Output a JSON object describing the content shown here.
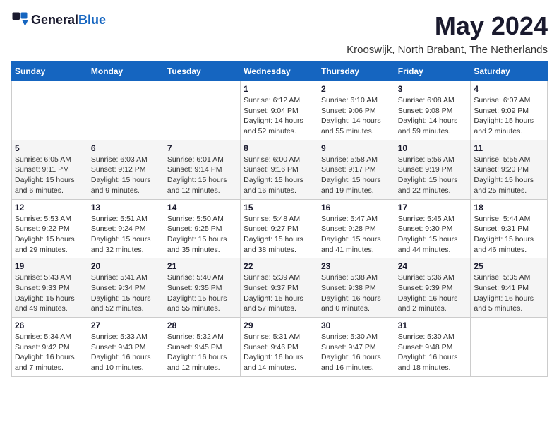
{
  "header": {
    "logo_general": "General",
    "logo_blue": "Blue",
    "month": "May 2024",
    "location": "Krooswijk, North Brabant, The Netherlands"
  },
  "days_of_week": [
    "Sunday",
    "Monday",
    "Tuesday",
    "Wednesday",
    "Thursday",
    "Friday",
    "Saturday"
  ],
  "weeks": [
    [
      {
        "day": "",
        "info": ""
      },
      {
        "day": "",
        "info": ""
      },
      {
        "day": "",
        "info": ""
      },
      {
        "day": "1",
        "info": "Sunrise: 6:12 AM\nSunset: 9:04 PM\nDaylight: 14 hours and 52 minutes."
      },
      {
        "day": "2",
        "info": "Sunrise: 6:10 AM\nSunset: 9:06 PM\nDaylight: 14 hours and 55 minutes."
      },
      {
        "day": "3",
        "info": "Sunrise: 6:08 AM\nSunset: 9:08 PM\nDaylight: 14 hours and 59 minutes."
      },
      {
        "day": "4",
        "info": "Sunrise: 6:07 AM\nSunset: 9:09 PM\nDaylight: 15 hours and 2 minutes."
      }
    ],
    [
      {
        "day": "5",
        "info": "Sunrise: 6:05 AM\nSunset: 9:11 PM\nDaylight: 15 hours and 6 minutes."
      },
      {
        "day": "6",
        "info": "Sunrise: 6:03 AM\nSunset: 9:12 PM\nDaylight: 15 hours and 9 minutes."
      },
      {
        "day": "7",
        "info": "Sunrise: 6:01 AM\nSunset: 9:14 PM\nDaylight: 15 hours and 12 minutes."
      },
      {
        "day": "8",
        "info": "Sunrise: 6:00 AM\nSunset: 9:16 PM\nDaylight: 15 hours and 16 minutes."
      },
      {
        "day": "9",
        "info": "Sunrise: 5:58 AM\nSunset: 9:17 PM\nDaylight: 15 hours and 19 minutes."
      },
      {
        "day": "10",
        "info": "Sunrise: 5:56 AM\nSunset: 9:19 PM\nDaylight: 15 hours and 22 minutes."
      },
      {
        "day": "11",
        "info": "Sunrise: 5:55 AM\nSunset: 9:20 PM\nDaylight: 15 hours and 25 minutes."
      }
    ],
    [
      {
        "day": "12",
        "info": "Sunrise: 5:53 AM\nSunset: 9:22 PM\nDaylight: 15 hours and 29 minutes."
      },
      {
        "day": "13",
        "info": "Sunrise: 5:51 AM\nSunset: 9:24 PM\nDaylight: 15 hours and 32 minutes."
      },
      {
        "day": "14",
        "info": "Sunrise: 5:50 AM\nSunset: 9:25 PM\nDaylight: 15 hours and 35 minutes."
      },
      {
        "day": "15",
        "info": "Sunrise: 5:48 AM\nSunset: 9:27 PM\nDaylight: 15 hours and 38 minutes."
      },
      {
        "day": "16",
        "info": "Sunrise: 5:47 AM\nSunset: 9:28 PM\nDaylight: 15 hours and 41 minutes."
      },
      {
        "day": "17",
        "info": "Sunrise: 5:45 AM\nSunset: 9:30 PM\nDaylight: 15 hours and 44 minutes."
      },
      {
        "day": "18",
        "info": "Sunrise: 5:44 AM\nSunset: 9:31 PM\nDaylight: 15 hours and 46 minutes."
      }
    ],
    [
      {
        "day": "19",
        "info": "Sunrise: 5:43 AM\nSunset: 9:33 PM\nDaylight: 15 hours and 49 minutes."
      },
      {
        "day": "20",
        "info": "Sunrise: 5:41 AM\nSunset: 9:34 PM\nDaylight: 15 hours and 52 minutes."
      },
      {
        "day": "21",
        "info": "Sunrise: 5:40 AM\nSunset: 9:35 PM\nDaylight: 15 hours and 55 minutes."
      },
      {
        "day": "22",
        "info": "Sunrise: 5:39 AM\nSunset: 9:37 PM\nDaylight: 15 hours and 57 minutes."
      },
      {
        "day": "23",
        "info": "Sunrise: 5:38 AM\nSunset: 9:38 PM\nDaylight: 16 hours and 0 minutes."
      },
      {
        "day": "24",
        "info": "Sunrise: 5:36 AM\nSunset: 9:39 PM\nDaylight: 16 hours and 2 minutes."
      },
      {
        "day": "25",
        "info": "Sunrise: 5:35 AM\nSunset: 9:41 PM\nDaylight: 16 hours and 5 minutes."
      }
    ],
    [
      {
        "day": "26",
        "info": "Sunrise: 5:34 AM\nSunset: 9:42 PM\nDaylight: 16 hours and 7 minutes."
      },
      {
        "day": "27",
        "info": "Sunrise: 5:33 AM\nSunset: 9:43 PM\nDaylight: 16 hours and 10 minutes."
      },
      {
        "day": "28",
        "info": "Sunrise: 5:32 AM\nSunset: 9:45 PM\nDaylight: 16 hours and 12 minutes."
      },
      {
        "day": "29",
        "info": "Sunrise: 5:31 AM\nSunset: 9:46 PM\nDaylight: 16 hours and 14 minutes."
      },
      {
        "day": "30",
        "info": "Sunrise: 5:30 AM\nSunset: 9:47 PM\nDaylight: 16 hours and 16 minutes."
      },
      {
        "day": "31",
        "info": "Sunrise: 5:30 AM\nSunset: 9:48 PM\nDaylight: 16 hours and 18 minutes."
      },
      {
        "day": "",
        "info": ""
      }
    ]
  ]
}
